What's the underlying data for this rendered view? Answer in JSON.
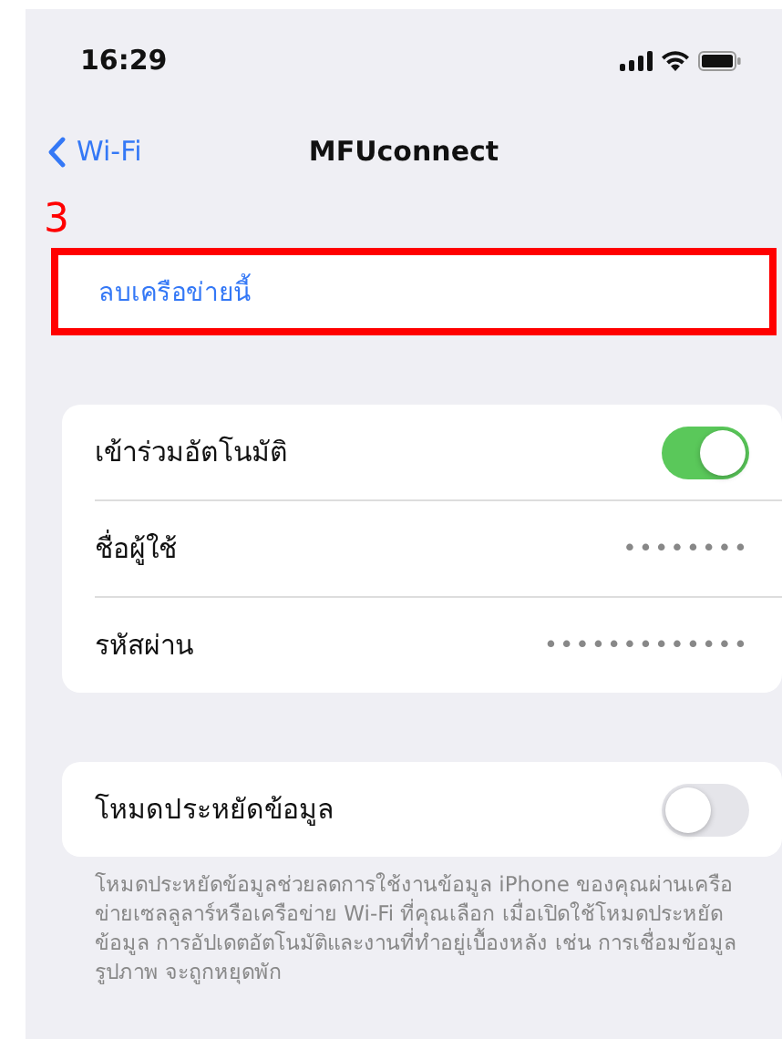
{
  "status_bar": {
    "time": "16:29"
  },
  "nav": {
    "back": "Wi-Fi",
    "title": "MFUconnect"
  },
  "annotation": {
    "number": "3"
  },
  "forget_row": {
    "label": "ลบเครือข่ายนี้"
  },
  "settings": [
    {
      "kind": "toggle",
      "label": "เข้าร่วมอัตโนมัติ",
      "on": true
    },
    {
      "kind": "value",
      "label": "ชื่อผู้ใช้",
      "value": "••••••••"
    },
    {
      "kind": "value",
      "label": "รหัสผ่าน",
      "value": "•••••••••••••"
    }
  ],
  "low_data": {
    "label": "โหมดประหยัดข้อมูล",
    "on": false,
    "footer": "โหมดประหยัดข้อมูลช่วยลดการใช้งานข้อมูล iPhone ของคุณผ่านเครือข่ายเซลลูลาร์หรือเครือข่าย Wi-Fi ที่คุณเลือก เมื่อเปิดใช้โหมดประหยัดข้อมูล การอัปเดตอัตโนมัติและงานที่ทำอยู่เบื้องหลัง เช่น การเชื่อมข้อมูลรูปภาพ จะถูกหยุดพัก"
  }
}
